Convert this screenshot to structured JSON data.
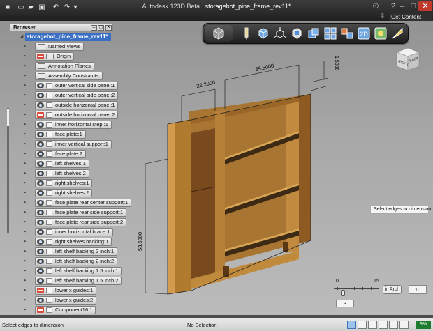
{
  "app": {
    "title_app": "Autodesk 123D Beta",
    "title_file": "storagebot_pine_frame_rev11*",
    "get_content": "Get Content"
  },
  "quick_access": {
    "new_icon": "new-icon",
    "open_icon": "open-icon",
    "save_icon": "save-icon",
    "undo_icon": "undo-icon",
    "redo_icon": "redo-icon"
  },
  "browser": {
    "title": "Browser",
    "root": "storagebot_pine_frame_rev11*",
    "nodes": [
      {
        "label": "Named Views",
        "kind": "folder"
      },
      {
        "label": "Origin",
        "kind": "hidden-folder"
      },
      {
        "label": "Annotation Planes",
        "kind": "folder"
      },
      {
        "label": "Assembly Constraints",
        "kind": "folder"
      },
      {
        "label": "outer vertical side panel:1",
        "kind": "visible"
      },
      {
        "label": "outer vertical side panel:2",
        "kind": "visible"
      },
      {
        "label": "outside horizontal panel:1",
        "kind": "visible"
      },
      {
        "label": "outside horizontal panel:2",
        "kind": "hidden"
      },
      {
        "label": "inner horizontal step :1",
        "kind": "visible"
      },
      {
        "label": "face plate:1",
        "kind": "visible"
      },
      {
        "label": "inner vertical support:1",
        "kind": "visible"
      },
      {
        "label": "face plate:2",
        "kind": "visible"
      },
      {
        "label": "left shelves:1",
        "kind": "visible"
      },
      {
        "label": "left shelves:2",
        "kind": "visible"
      },
      {
        "label": "right shelves:1",
        "kind": "visible"
      },
      {
        "label": "right shelves:2",
        "kind": "visible"
      },
      {
        "label": "face plate rear center support:1",
        "kind": "visible"
      },
      {
        "label": "face plate rear side support:1",
        "kind": "visible"
      },
      {
        "label": "face plate rear side support:2",
        "kind": "visible"
      },
      {
        "label": "inner horizontal brace:1",
        "kind": "visible"
      },
      {
        "label": "right shelves backing:1",
        "kind": "visible"
      },
      {
        "label": "left shelf backing 2 inch:1",
        "kind": "visible"
      },
      {
        "label": "left shelf backing 2 inch:2",
        "kind": "visible"
      },
      {
        "label": "left shelf backing 1.5 inch:1",
        "kind": "visible"
      },
      {
        "label": "left shelf backing 1.5 inch:2",
        "kind": "visible"
      },
      {
        "label": "lower x guides:1",
        "kind": "hidden"
      },
      {
        "label": "lower x guides:2",
        "kind": "visible"
      },
      {
        "label": "Component16:1",
        "kind": "hidden"
      }
    ]
  },
  "dimensions": {
    "width_left": "22.2000",
    "width_right": "39.5000",
    "height": "53.5000",
    "depth": "1.5000"
  },
  "viewcube": {
    "right": "RIGHT",
    "back": "BACK"
  },
  "tooltip": "Select edges to dimension",
  "snap": {
    "min": "0",
    "max": "15",
    "value": "3",
    "unit_button": "in Arch",
    "grid_value": "10"
  },
  "status": {
    "hint": "Select edges to dimension",
    "selection": "No Selection",
    "percent": "9%"
  },
  "colors": {
    "wood": "#b07a2f",
    "wood_dark": "#6a4419",
    "selection": "#3a6fc4"
  }
}
